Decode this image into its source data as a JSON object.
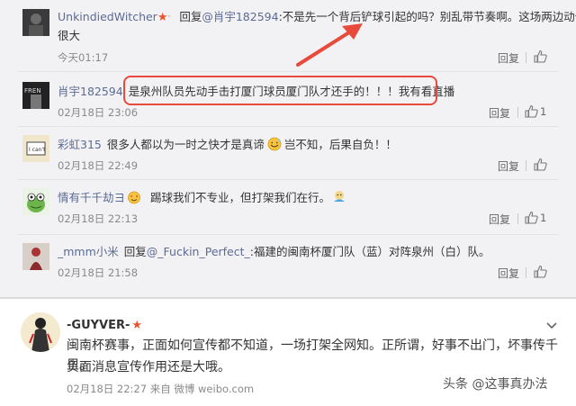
{
  "comments": [
    {
      "user": "UnkindiedWitcher",
      "reply_prefix": "回复",
      "reply_to": "@肖宇182594",
      "text_line1": ":不是先一个背后铲球引起的吗？别乱带节奏啊。这场两边动作都",
      "text_line2": "很大",
      "time": "今天01:17",
      "reply_label": "回复",
      "likes": ""
    },
    {
      "user": "肖宇182594",
      "text": "是泉州队员先动手击打厦门球员厦门队才还手的！！！我有看直播",
      "time": "02月18日 23:06",
      "reply_label": "回复",
      "likes": "1"
    },
    {
      "user": "彩虹315",
      "text_a": "很多人都以为一时之快才是真谛",
      "text_b": "岂不知，后果自负！！",
      "time": "02月18日 22:49",
      "reply_label": "回复",
      "likes": ""
    },
    {
      "user": "情有千千劫ヨ",
      "text": "踢球我们不专业，但打架我们在行。",
      "time": "02月18日 22:13",
      "reply_label": "回复",
      "likes": "1"
    },
    {
      "user": "_mmm小米",
      "reply_prefix": "回复",
      "reply_to": "@_Fuckin_Perfect_",
      "text": ":福建的闽南杯厦门队（蓝）对阵泉州（白）队。",
      "time": "02月18日 21:58",
      "reply_label": "回复",
      "likes": ""
    }
  ],
  "post": {
    "user": "-GUYVER-",
    "line1": "闽南杯赛事，正面如何宣传都不知道，一场打架全网知。正所谓，好事不出门，坏事传千里。",
    "line2": "负面消息宣传作用还是大哦。",
    "meta": "02月18日 22:27 来自 微博 weibo.com"
  },
  "watermark": "头条 @这事真办法",
  "colors": {
    "highlight": "#e84a3c",
    "username": "#5c6b94",
    "vip_star": "#e8542e"
  }
}
